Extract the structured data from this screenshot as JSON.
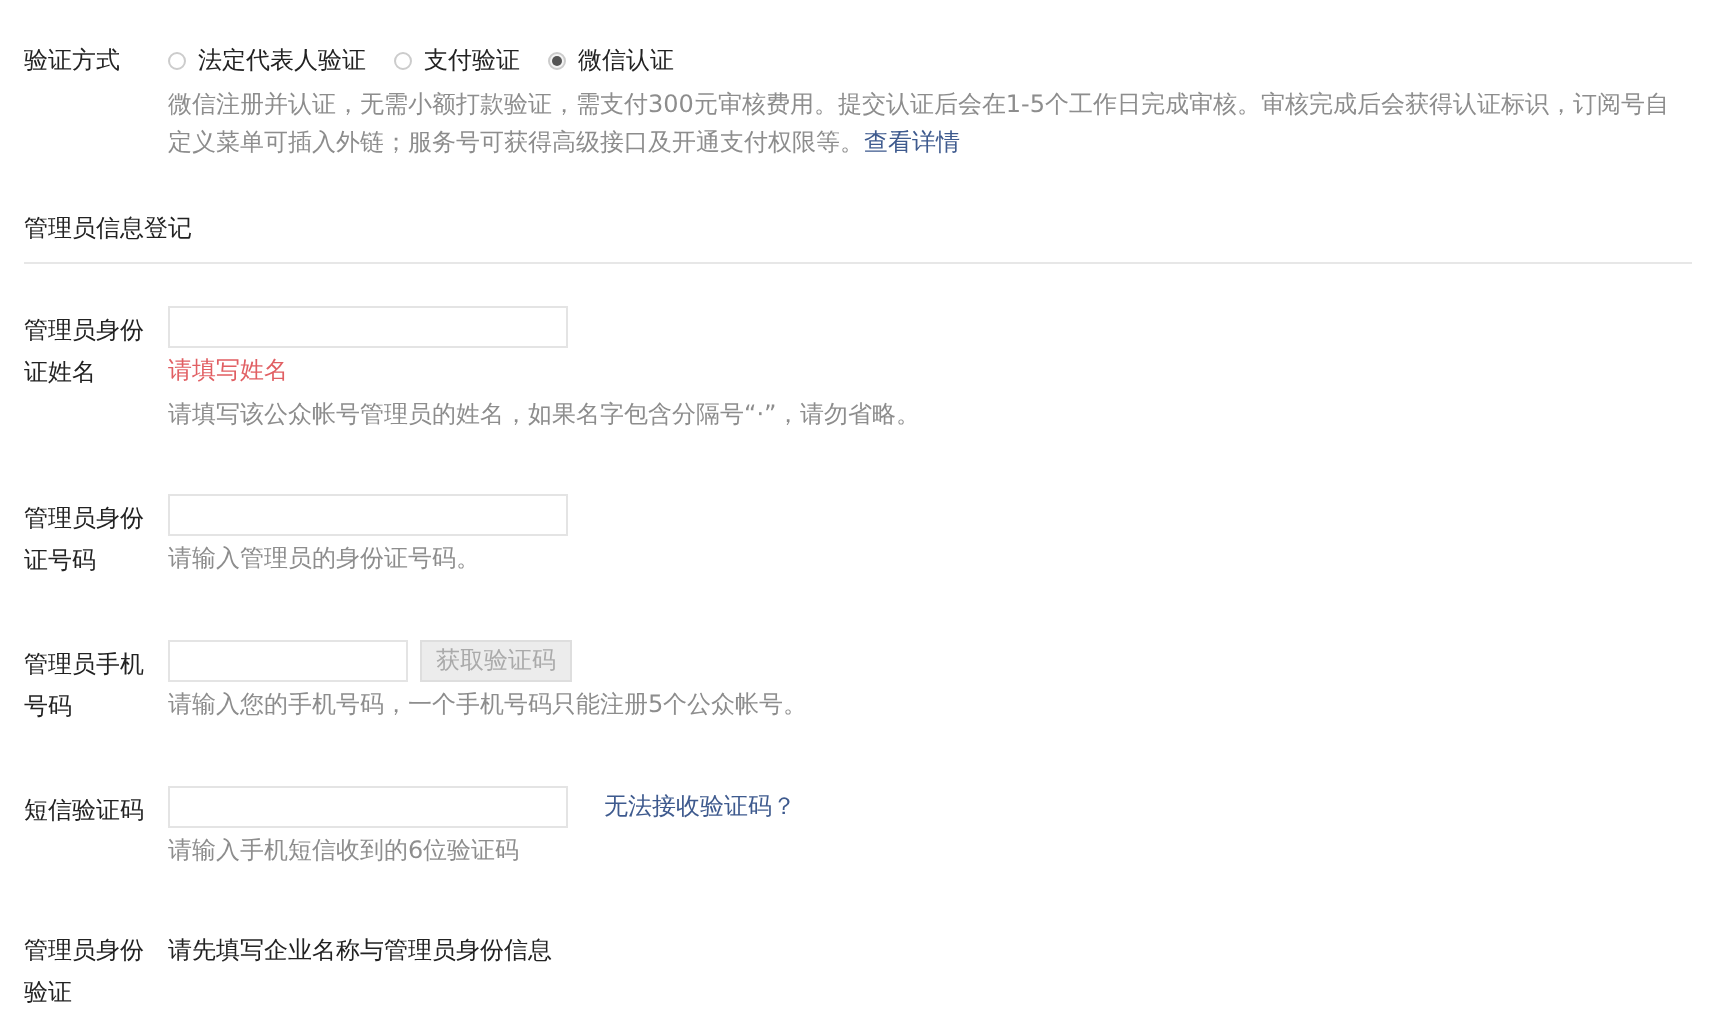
{
  "verification": {
    "label": "验证方式",
    "options": [
      {
        "label": "法定代表人验证",
        "selected": false
      },
      {
        "label": "支付验证",
        "selected": false
      },
      {
        "label": "微信认证",
        "selected": true
      }
    ],
    "description": "微信注册并认证，无需小额打款验证，需支付300元审核费用。提交认证后会在1-5个工作日完成审核。审核完成后会获得认证标识，订阅号自定义菜单可插入外链；服务号可获得高级接口及开通支付权限等。",
    "link": "查看详情"
  },
  "section_title": "管理员信息登记",
  "rows": [
    {
      "kind": "input",
      "label": "管理员身份证姓名",
      "error": "请填写姓名",
      "hint": "请填写该公众帐号管理员的姓名，如果名字包含分隔号“·”，请勿省略。"
    },
    {
      "kind": "input",
      "label": "管理员身份证号码",
      "hint": "请输入管理员的身份证号码。"
    },
    {
      "kind": "input_button",
      "label": "管理员手机号码",
      "button": {
        "label": "获取验证码",
        "disabled": true
      },
      "hint": "请输入您的手机号码，一个手机号码只能注册5个公众帐号。"
    },
    {
      "kind": "input_link",
      "label": "短信验证码",
      "link": "无法接收验证码？",
      "hint": "请输入手机短信收到的6位验证码"
    },
    {
      "kind": "text",
      "label": "管理员身份验证",
      "text": "请先填写企业名称与管理员身份信息"
    }
  ]
}
